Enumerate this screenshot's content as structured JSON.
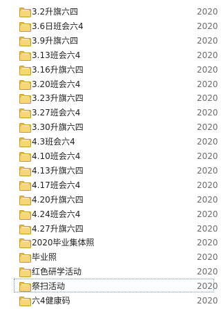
{
  "file_list": {
    "icon": "folder-icon",
    "items": [
      {
        "name": "3.2升旗六四",
        "date": "2020"
      },
      {
        "name": "3.6日班会六4",
        "date": "2020"
      },
      {
        "name": "3.9升旗六四",
        "date": "2020"
      },
      {
        "name": "3.13班会六4",
        "date": "2020"
      },
      {
        "name": "3.16升旗六四",
        "date": "2020"
      },
      {
        "name": "3.20班会六4",
        "date": "2020"
      },
      {
        "name": "3.23升旗六四",
        "date": "2020"
      },
      {
        "name": "3.27班会六4",
        "date": "2020"
      },
      {
        "name": "3.30升旗六四",
        "date": "2020"
      },
      {
        "name": "4.3班会六4",
        "date": "2020"
      },
      {
        "name": "4.10班会六4",
        "date": "2020"
      },
      {
        "name": "4.13升旗六四",
        "date": "2020"
      },
      {
        "name": "4.17班会六4",
        "date": "2020"
      },
      {
        "name": "4.20升旗六四",
        "date": "2020"
      },
      {
        "name": "4.24班会六4",
        "date": "2020"
      },
      {
        "name": "4.27升旗六四",
        "date": "2020"
      },
      {
        "name": "2020毕业集体照",
        "date": "2020"
      },
      {
        "name": "毕业照",
        "date": "2020"
      },
      {
        "name": "红色研学活动",
        "date": "2020"
      },
      {
        "name": "祭扫活动",
        "date": "2020"
      },
      {
        "name": "六4健康码",
        "date": "2020"
      }
    ],
    "selected_index": 19
  }
}
